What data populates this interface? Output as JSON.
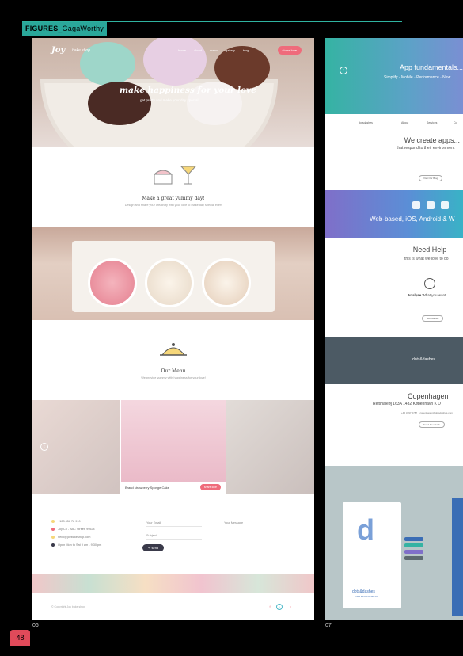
{
  "section_tag": {
    "prefix": "FIGURES",
    "suffix": "_GagaWorthy"
  },
  "page_number": "48",
  "figures": {
    "left": "06",
    "right": "07"
  },
  "left_site": {
    "logo": "Joy",
    "logo_sub": "bake shop",
    "nav": [
      "home",
      "about",
      "menu",
      "gallery",
      "blog"
    ],
    "order_button": "share love",
    "hero_title": "make happiness for your love",
    "hero_sub": "get pretty and make your day special",
    "section1_title": "Make a great yummy day!",
    "section1_sub": "Design and share your creativity with your love to make day special ever!",
    "menu_title": "Our Menu",
    "menu_sub": "We provide yummy with happiness for your love!",
    "gallery_caption": "Brand strawberry Sponge Cake",
    "gallery_button": "share love",
    "contact": [
      "+123 456 78 910",
      "Joy Co - ABC Street, 99524",
      "hello@joybakeshop.com",
      "Open Mon to Sat 9 am - 9:30 pm"
    ],
    "form_fields": {
      "email": "Your Email",
      "subject": "Subject",
      "message": "Your Message"
    },
    "send_button": "send",
    "copyright": "© Copyright Joy bake shop",
    "colors": {
      "accent": "#ef6b7b",
      "dark": "#3a3a4a"
    }
  },
  "right_site": {
    "hero_title": "App fundamentals...",
    "hero_sub": "Simplify · Mobile · Performance · New",
    "nav": [
      "dotsdashes",
      "About",
      "Services",
      "Co"
    ],
    "create_title": "We create apps...",
    "create_sub": "that respond to their environment",
    "create_button": "Visit Our Blog",
    "platform_title": "Web-based, iOS, Android & W",
    "help_title": "Need Help",
    "help_sub": "this is what we love to do",
    "analyse_label": "Analyse",
    "analyse_rest": "What you want",
    "help_button": "Get Started",
    "map_logo": "dots&dashes",
    "city": "Copenhagen",
    "address": "Refshaleøj 163A   1432 København K   D",
    "phone": "+45 3297 6787",
    "email": "copenhagen@dotsdashes.com",
    "contact_button": "Send Feedback",
    "card_logo": "dots&dashes",
    "card_sub": "APP DEV COMPANY",
    "colors": {
      "teal": "#35b3a3",
      "purple": "#7f6fc9",
      "blue": "#3a6db5"
    }
  }
}
